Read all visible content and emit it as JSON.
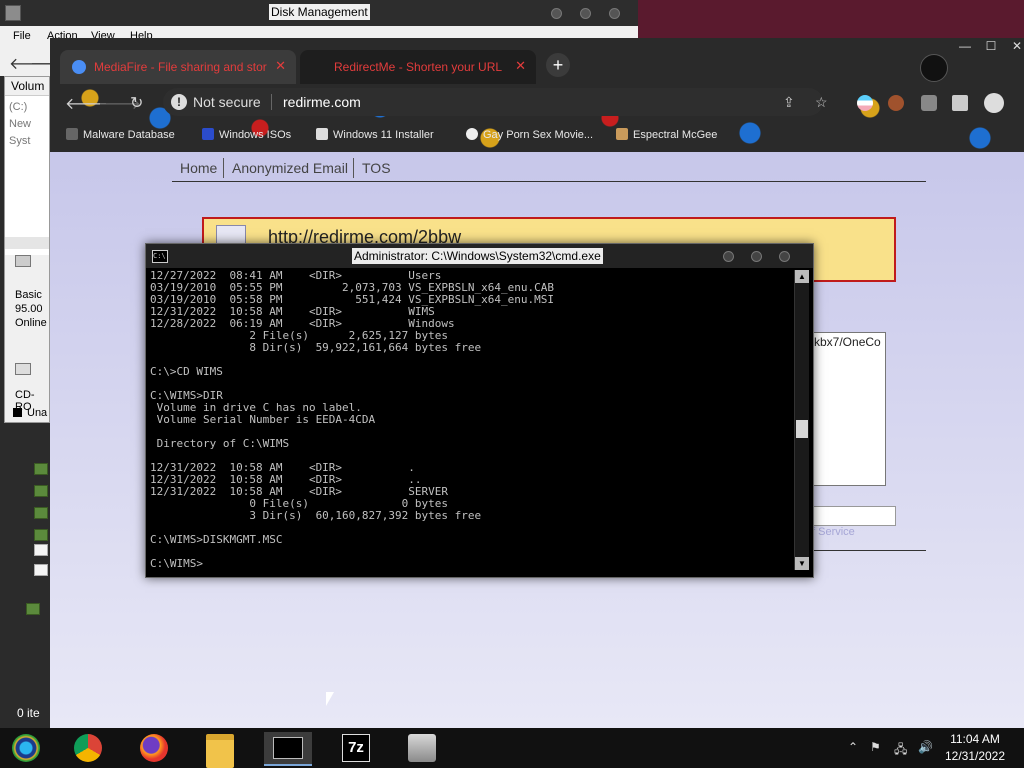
{
  "disk_management": {
    "title": "Disk Management",
    "menu": [
      "File",
      "Action",
      "View",
      "Help"
    ],
    "volume_header": "Volum",
    "volumes": [
      "(C:)",
      "New",
      "Syst"
    ],
    "disk_info": [
      "Basic",
      "95.00",
      "Online"
    ],
    "cdrom": "CD-RO",
    "legend_unallocated": "Una",
    "status": "0 ite"
  },
  "browser": {
    "tabs": [
      {
        "title": "MediaFire - File sharing and stor",
        "close": "✕"
      },
      {
        "title": "RedirectMe - Shorten your URL",
        "close": "✕"
      }
    ],
    "new_tab": "+",
    "omnibox": {
      "security": "Not secure",
      "url": "redirme.com"
    },
    "bookmarks": [
      "Malware Database",
      "Windows ISOs",
      "Windows 11 Installer",
      "Gay Porn Sex Movie...",
      "Espectral McGee"
    ],
    "page": {
      "nav": [
        "Home",
        "Anonymized Email",
        "TOS"
      ],
      "short_link": "http://redirme.com/2bbw",
      "textarea_fragment": "kbx7/OneCo",
      "terms_fragment": "f Service"
    }
  },
  "cmd": {
    "title": "Administrator: C:\\Windows\\System32\\cmd.exe",
    "lines": [
      "12/27/2022  08:41 AM    <DIR>          Users",
      "03/19/2010  05:55 PM         2,073,703 VS_EXPBSLN_x64_enu.CAB",
      "03/19/2010  05:58 PM           551,424 VS_EXPBSLN_x64_enu.MSI",
      "12/31/2022  10:58 AM    <DIR>          WIMS",
      "12/28/2022  06:19 AM    <DIR>          Windows",
      "               2 File(s)      2,625,127 bytes",
      "               8 Dir(s)  59,922,161,664 bytes free",
      "",
      "C:\\>CD WIMS",
      "",
      "C:\\WIMS>DIR",
      " Volume in drive C has no label.",
      " Volume Serial Number is EEDA-4CDA",
      "",
      " Directory of C:\\WIMS",
      "",
      "12/31/2022  10:58 AM    <DIR>          .",
      "12/31/2022  10:58 AM    <DIR>          ..",
      "12/31/2022  10:58 AM    <DIR>          SERVER",
      "               0 File(s)              0 bytes",
      "               3 Dir(s)  60,160,827,392 bytes free",
      "",
      "C:\\WIMS>DISKMGMT.MSC",
      "",
      "C:\\WIMS>"
    ]
  },
  "taskbar": {
    "apps": [
      "start-icon",
      "chrome-icon",
      "firefox-icon",
      "file-explorer-icon",
      "cmd-icon",
      "7zip-icon",
      "disk-utility-icon"
    ],
    "sevenzip_label": "7z",
    "time": "11:04 AM",
    "date": "12/31/2022"
  }
}
